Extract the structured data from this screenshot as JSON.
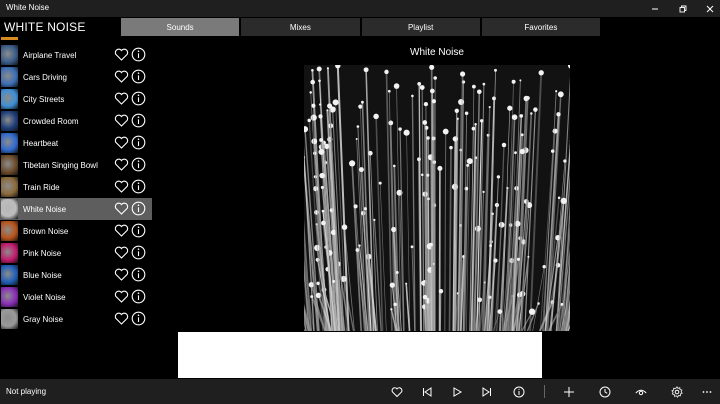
{
  "window": {
    "title": "White Noise"
  },
  "app": {
    "title": "WHITE NOISE"
  },
  "tabs": [
    {
      "label": "Sounds"
    },
    {
      "label": "Mixes"
    },
    {
      "label": "Playlist"
    },
    {
      "label": "Favorites"
    }
  ],
  "sounds": [
    {
      "label": "Airplane Travel",
      "thumb_color": "#3a5d8a"
    },
    {
      "label": "Cars Driving",
      "thumb_color": "#3b6fb6"
    },
    {
      "label": "City Streets",
      "thumb_color": "#3d8fd6"
    },
    {
      "label": "Crowded Room",
      "thumb_color": "#1e3f7a"
    },
    {
      "label": "Heartbeat",
      "thumb_color": "#2f6ad0"
    },
    {
      "label": "Tibetan Singing Bowl",
      "thumb_color": "#6b4b2a"
    },
    {
      "label": "Train Ride",
      "thumb_color": "#8a6a3a"
    },
    {
      "label": "White Noise",
      "thumb_color": "#bdbdbd"
    },
    {
      "label": "Brown Noise",
      "thumb_color": "#b9531a"
    },
    {
      "label": "Pink Noise",
      "thumb_color": "#c4196e"
    },
    {
      "label": "Blue Noise",
      "thumb_color": "#1f5fb8"
    },
    {
      "label": "Violet Noise",
      "thumb_color": "#8a2cb8"
    },
    {
      "label": "Gray Noise",
      "thumb_color": "#9a9a9a"
    }
  ],
  "selected_sound": "White Noise",
  "now_showing": {
    "title": "White Noise"
  },
  "status": {
    "text": "Not playing"
  },
  "bottom_icons": [
    "heart-icon",
    "previous-icon",
    "play-icon",
    "next-icon",
    "info-icon",
    "add-icon",
    "timer-icon",
    "eye-icon",
    "gear-icon",
    "more-icon"
  ],
  "colors": {
    "active_tab": "#7a7a7a",
    "selected_row": "#5e5e5e",
    "bar": "#1f1f1f"
  }
}
